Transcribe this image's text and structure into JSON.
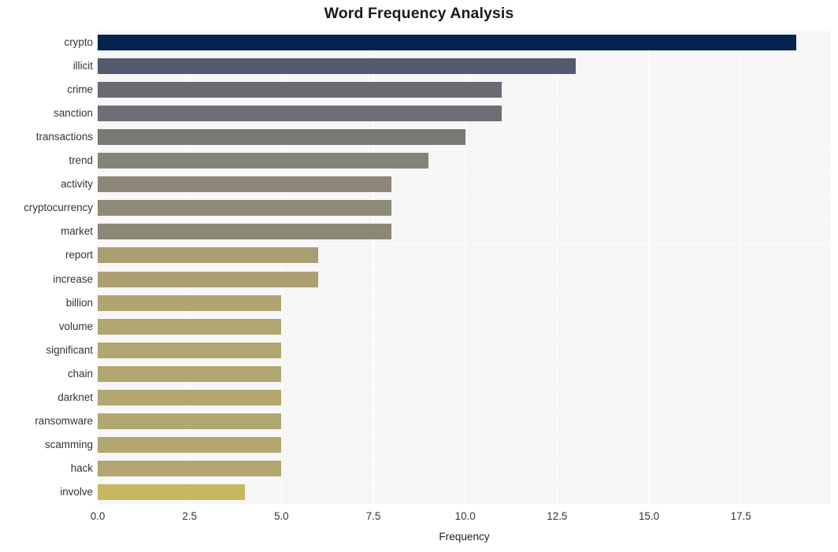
{
  "chart_data": {
    "type": "bar",
    "orientation": "horizontal",
    "title": "Word Frequency Analysis",
    "xlabel": "Frequency",
    "ylabel": "",
    "categories": [
      "crypto",
      "illicit",
      "crime",
      "sanction",
      "transactions",
      "trend",
      "activity",
      "cryptocurrency",
      "market",
      "report",
      "increase",
      "billion",
      "volume",
      "significant",
      "chain",
      "darknet",
      "ransomware",
      "scamming",
      "hack",
      "involve"
    ],
    "values": [
      19,
      13,
      11,
      11,
      10,
      9,
      8,
      8,
      8,
      6,
      6,
      5,
      5,
      5,
      5,
      5,
      5,
      5,
      5,
      4
    ],
    "xlim": [
      0,
      19.95
    ],
    "xticks": [
      0.0,
      2.5,
      5.0,
      7.5,
      10.0,
      12.5,
      15.0,
      17.5
    ],
    "xticklabels": [
      "0.0",
      "2.5",
      "5.0",
      "7.5",
      "10.0",
      "12.5",
      "15.0",
      "17.5"
    ],
    "grid": true,
    "grid_axis": "both",
    "legend": false,
    "bar_colors": [
      "#04244f",
      "#555a6e",
      "#6a6a73",
      "#6f6e77",
      "#787874",
      "#868479",
      "#8d8878",
      "#8e8b79",
      "#8b8877",
      "#a99e72",
      "#aca073",
      "#b0a472",
      "#b1a571",
      "#b1a571",
      "#b2a671",
      "#b2a671",
      "#b2a671",
      "#b2a671",
      "#b3a571",
      "#c5b85f"
    ],
    "plot_background": "#f6f6f7",
    "gridline_color": "#ffffff",
    "title_color": "#1a1a1a",
    "tick_label_color": "#333333"
  }
}
